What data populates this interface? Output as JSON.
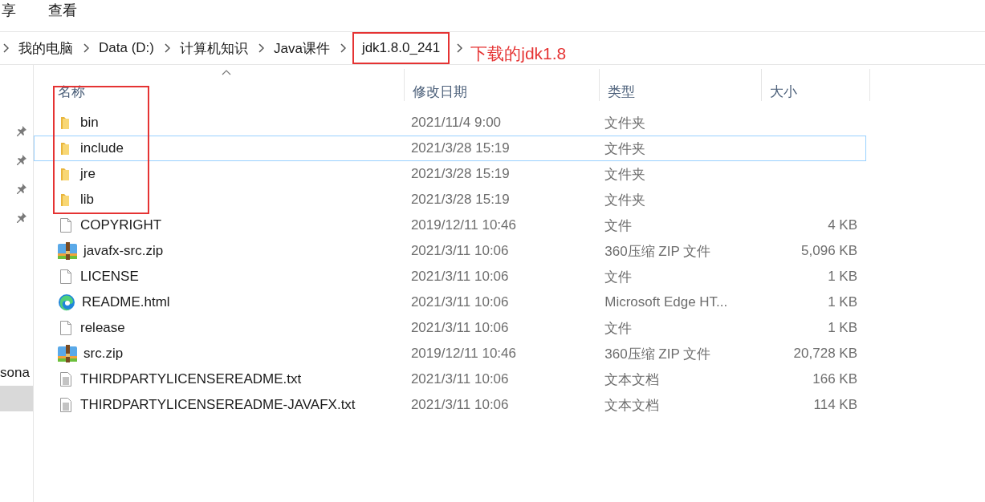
{
  "menu": [
    "享",
    "查看"
  ],
  "breadcrumb": [
    {
      "label": "我的电脑",
      "highlighted": false
    },
    {
      "label": "Data (D:)",
      "highlighted": false
    },
    {
      "label": "计算机知识",
      "highlighted": false
    },
    {
      "label": "Java课件",
      "highlighted": false
    },
    {
      "label": "jdk1.8.0_241",
      "highlighted": true
    }
  ],
  "annotation": "下载的jdk1.8",
  "sidebar": {
    "items": [
      {
        "label": "sona",
        "selected": false
      },
      {
        "selected": true
      }
    ]
  },
  "columns": [
    "名称",
    "修改日期",
    "类型",
    "大小"
  ],
  "rows": [
    {
      "kind": "folder",
      "name": "bin",
      "date": "2021/11/4 9:00",
      "type": "文件夹",
      "size": "",
      "selected": false,
      "boxed": true
    },
    {
      "kind": "folder",
      "name": "include",
      "date": "2021/3/28 15:19",
      "type": "文件夹",
      "size": "",
      "selected": true,
      "boxed": true
    },
    {
      "kind": "folder",
      "name": "jre",
      "date": "2021/3/28 15:19",
      "type": "文件夹",
      "size": "",
      "selected": false,
      "boxed": true
    },
    {
      "kind": "folder",
      "name": "lib",
      "date": "2021/3/28 15:19",
      "type": "文件夹",
      "size": "",
      "selected": false,
      "boxed": true
    },
    {
      "kind": "file",
      "name": "COPYRIGHT",
      "date": "2019/12/11 10:46",
      "type": "文件",
      "size": "4 KB",
      "selected": false,
      "boxed": false
    },
    {
      "kind": "zip",
      "name": "javafx-src.zip",
      "date": "2021/3/11 10:06",
      "type": "360压缩 ZIP 文件",
      "size": "5,096 KB",
      "selected": false,
      "boxed": false
    },
    {
      "kind": "file",
      "name": "LICENSE",
      "date": "2021/3/11 10:06",
      "type": "文件",
      "size": "1 KB",
      "selected": false,
      "boxed": false
    },
    {
      "kind": "edge",
      "name": "README.html",
      "date": "2021/3/11 10:06",
      "type": "Microsoft Edge HT...",
      "size": "1 KB",
      "selected": false,
      "boxed": false
    },
    {
      "kind": "file",
      "name": "release",
      "date": "2021/3/11 10:06",
      "type": "文件",
      "size": "1 KB",
      "selected": false,
      "boxed": false
    },
    {
      "kind": "zip",
      "name": "src.zip",
      "date": "2019/12/11 10:46",
      "type": "360压缩 ZIP 文件",
      "size": "20,728 KB",
      "selected": false,
      "boxed": false
    },
    {
      "kind": "text",
      "name": "THIRDPARTYLICENSEREADME.txt",
      "date": "2021/3/11 10:06",
      "type": "文本文档",
      "size": "166 KB",
      "selected": false,
      "boxed": false
    },
    {
      "kind": "text",
      "name": "THIRDPARTYLICENSEREADME-JAVAFX.txt",
      "date": "2021/3/11 10:06",
      "type": "文本文档",
      "size": "114 KB",
      "selected": false,
      "boxed": false
    }
  ]
}
